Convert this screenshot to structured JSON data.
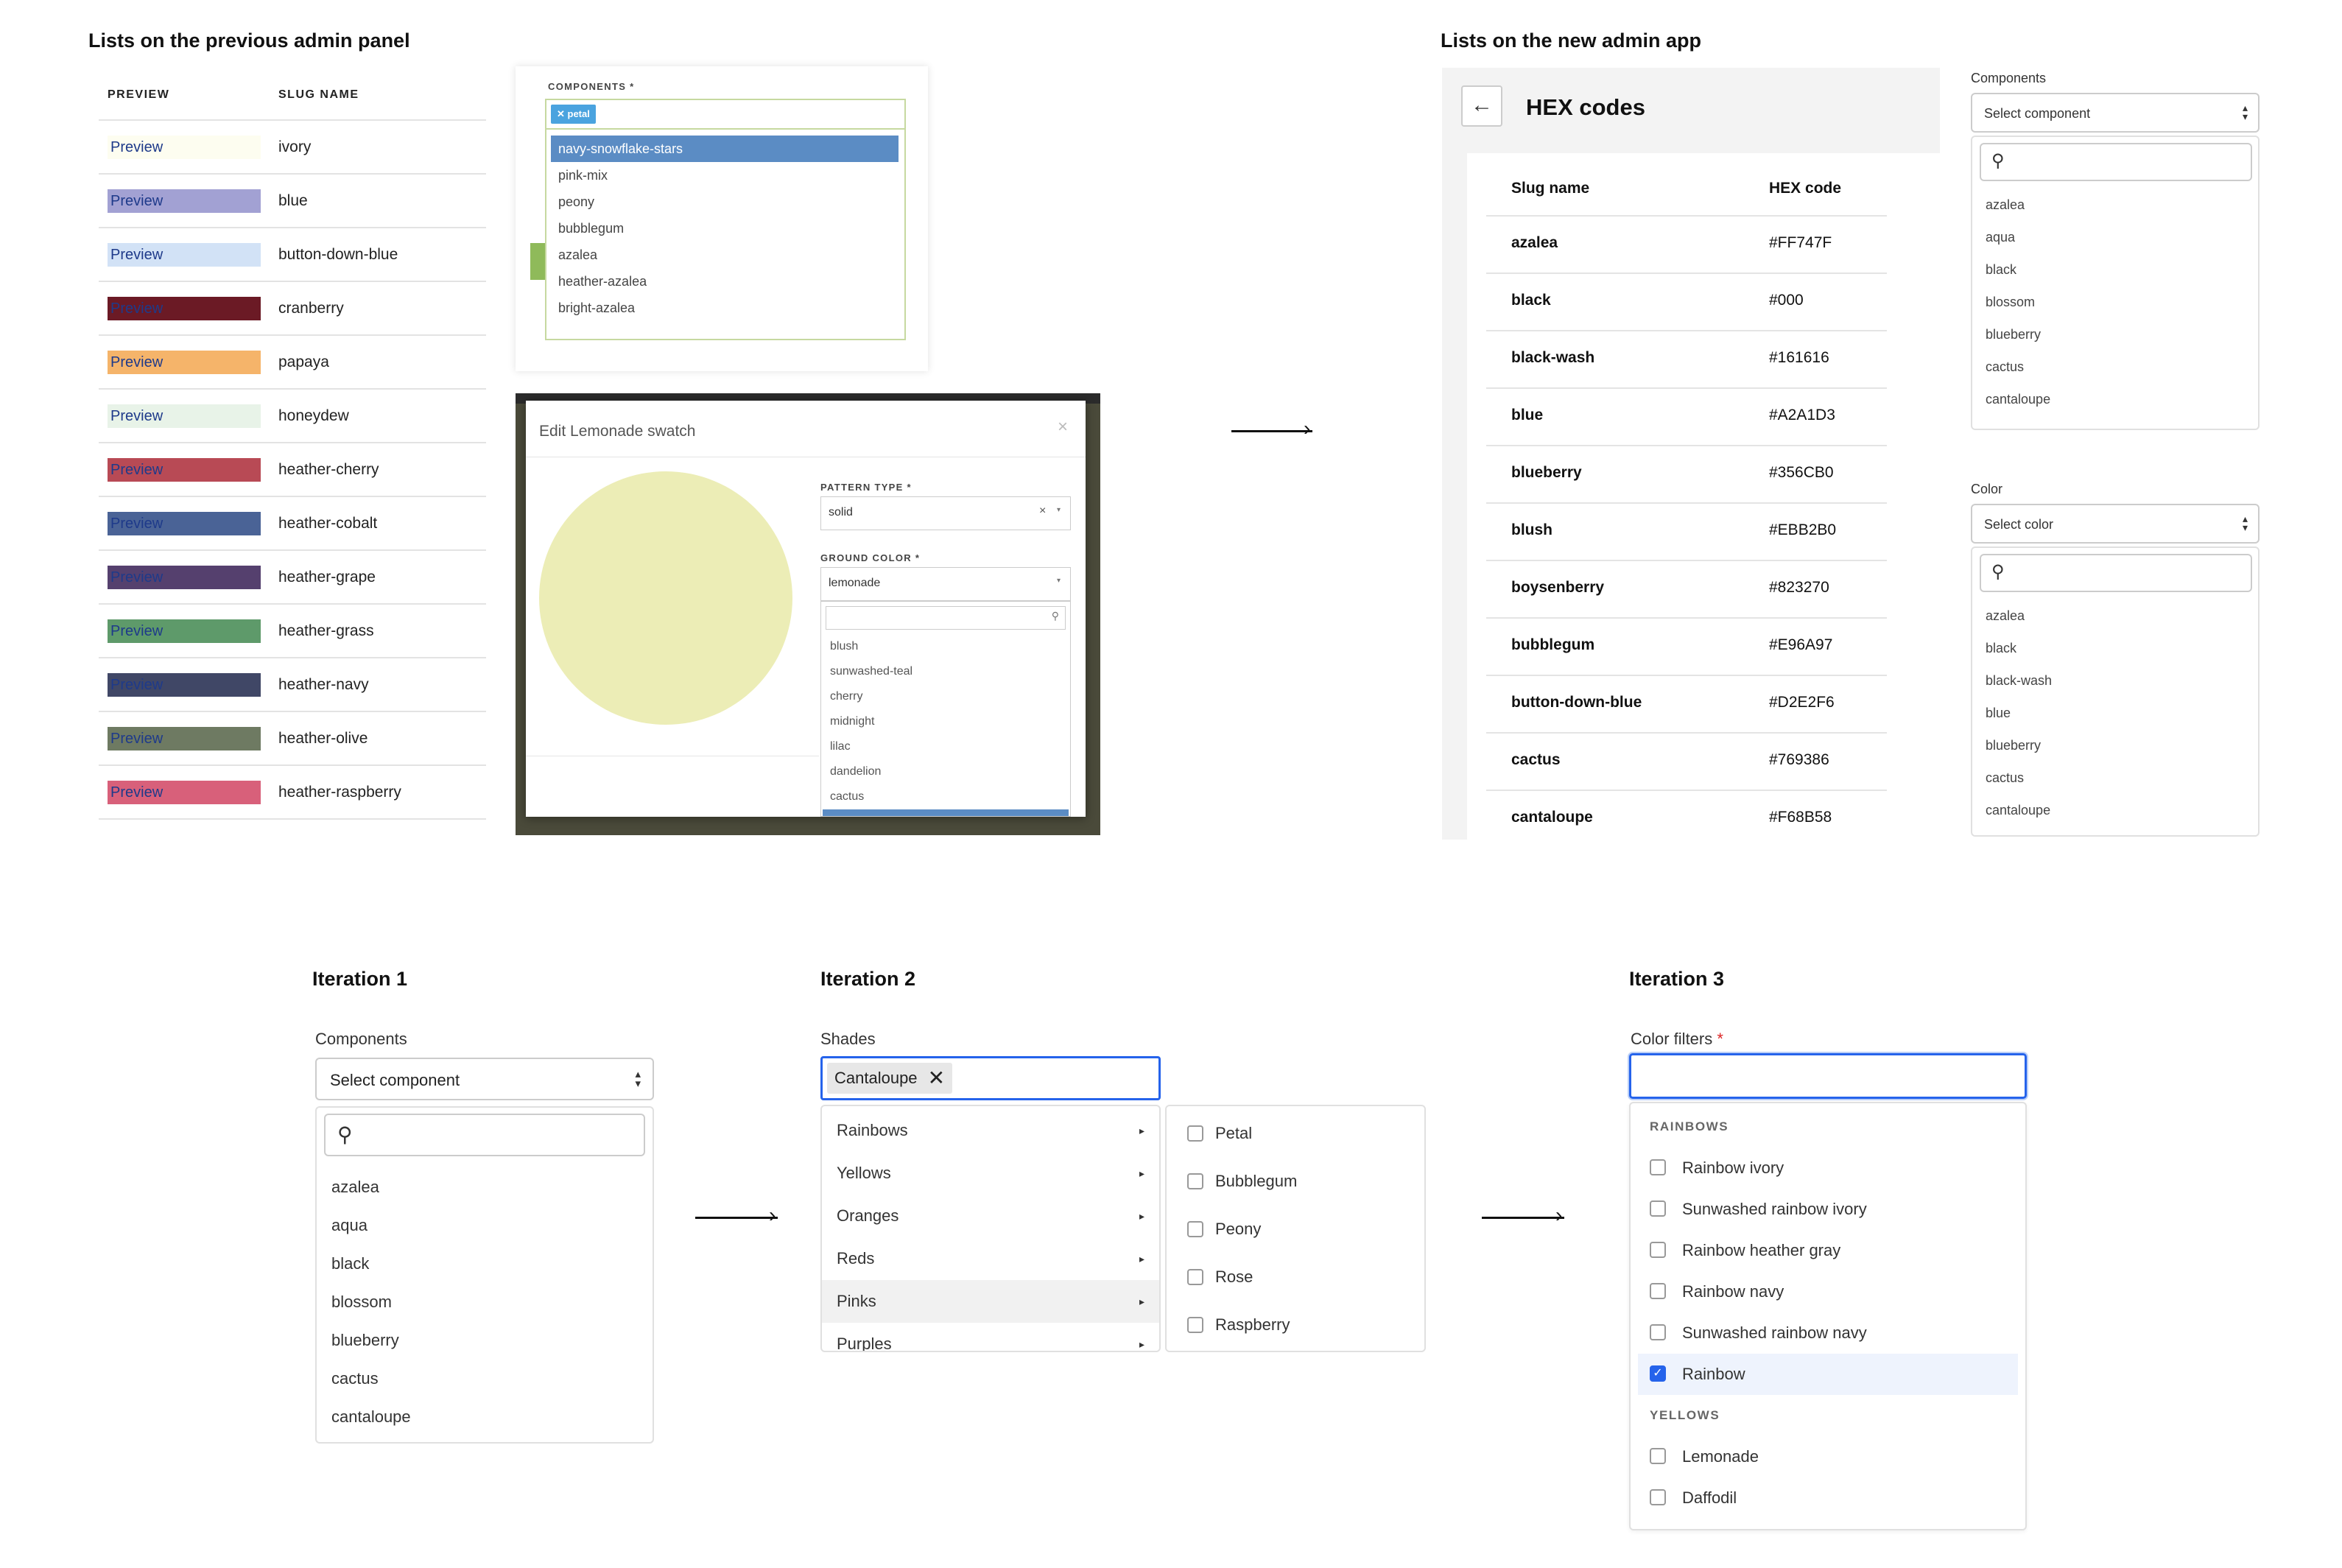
{
  "old_panel": {
    "heading": "Lists on the previous admin panel",
    "col_preview": "PREVIEW",
    "col_slug": "SLUG NAME",
    "preview_text": "Preview",
    "rows": [
      {
        "slug": "ivory",
        "color": "#fdfdf0"
      },
      {
        "slug": "blue",
        "color": "#a2a1d3"
      },
      {
        "slug": "button-down-blue",
        "color": "#d2e2f6"
      },
      {
        "slug": "cranberry",
        "color": "#6b1a25"
      },
      {
        "slug": "papaya",
        "color": "#f5b46a"
      },
      {
        "slug": "honeydew",
        "color": "#e8f3e8"
      },
      {
        "slug": "heather-cherry",
        "color": "#b84a55"
      },
      {
        "slug": "heather-cobalt",
        "color": "#4a6396"
      },
      {
        "slug": "heather-grape",
        "color": "#55406e"
      },
      {
        "slug": "heather-grass",
        "color": "#5e9a6a"
      },
      {
        "slug": "heather-navy",
        "color": "#404766"
      },
      {
        "slug": "heather-olive",
        "color": "#6e7a62"
      },
      {
        "slug": "heather-raspberry",
        "color": "#d8607a"
      }
    ]
  },
  "old_components": {
    "label": "COMPONENTS *",
    "tag": "petal",
    "options": [
      "navy-snowflake-stars",
      "pink-mix",
      "peony",
      "bubblegum",
      "azalea",
      "heather-azalea",
      "bright-azalea"
    ],
    "selected_index": 0
  },
  "old_modal": {
    "title": "Edit Lemonade swatch",
    "close": "×",
    "swatch_color": "#ecedb6",
    "pattern_label": "PATTERN TYPE *",
    "pattern_value": "solid",
    "ground_label": "GROUND COLOR *",
    "ground_value": "lemonade",
    "options": [
      "blush",
      "sunwashed-teal",
      "cherry",
      "midnight",
      "lilac",
      "dandelion",
      "cactus",
      "lemonade"
    ],
    "selected": "lemonade"
  },
  "new_app": {
    "heading": "Lists on the new admin app",
    "back_icon": "arrow-left-icon",
    "title": "HEX codes",
    "col_slug": "Slug name",
    "col_hex": "HEX code",
    "rows": [
      {
        "slug": "azalea",
        "hex": "#FF747F"
      },
      {
        "slug": "black",
        "hex": "#000"
      },
      {
        "slug": "black-wash",
        "hex": "#161616"
      },
      {
        "slug": "blue",
        "hex": "#A2A1D3"
      },
      {
        "slug": "blueberry",
        "hex": "#356CB0"
      },
      {
        "slug": "blush",
        "hex": "#EBB2B0"
      },
      {
        "slug": "boysenberry",
        "hex": "#823270"
      },
      {
        "slug": "bubblegum",
        "hex": "#E96A97"
      },
      {
        "slug": "button-down-blue",
        "hex": "#D2E2F6"
      },
      {
        "slug": "cactus",
        "hex": "#769386"
      },
      {
        "slug": "cantaloupe",
        "hex": "#F68B58"
      }
    ],
    "components": {
      "label": "Components",
      "placeholder": "Select component",
      "options": [
        "azalea",
        "aqua",
        "black",
        "blossom",
        "blueberry",
        "cactus",
        "cantaloupe"
      ]
    },
    "color": {
      "label": "Color",
      "placeholder": "Select color",
      "options": [
        "azalea",
        "black",
        "black-wash",
        "blue",
        "blueberry",
        "cactus",
        "cantaloupe"
      ]
    }
  },
  "iteration1": {
    "heading": "Iteration 1",
    "label": "Components",
    "placeholder": "Select component",
    "options": [
      "azalea",
      "aqua",
      "black",
      "blossom",
      "blueberry",
      "cactus",
      "cantaloupe"
    ]
  },
  "iteration2": {
    "heading": "Iteration 2",
    "label": "Shades",
    "chip": "Cantaloupe",
    "groups": [
      "Rainbows",
      "Yellows",
      "Oranges",
      "Reds",
      "Pinks",
      "Purples"
    ],
    "active_group": "Pinks",
    "submenu": [
      "Petal",
      "Bubblegum",
      "Peony",
      "Rose",
      "Raspberry"
    ]
  },
  "iteration3": {
    "heading": "Iteration 3",
    "label": "Color filters",
    "required_mark": "*",
    "group1": "RAINBOWS",
    "group1_items": [
      {
        "label": "Rainbow ivory",
        "checked": false
      },
      {
        "label": "Sunwashed rainbow ivory",
        "checked": false
      },
      {
        "label": "Rainbow heather gray",
        "checked": false
      },
      {
        "label": "Rainbow navy",
        "checked": false
      },
      {
        "label": "Sunwashed rainbow navy",
        "checked": false
      },
      {
        "label": "Rainbow",
        "checked": true
      }
    ],
    "group2": "YELLOWS",
    "group2_items": [
      {
        "label": "Lemonade",
        "checked": false
      },
      {
        "label": "Daffodil",
        "checked": false
      }
    ]
  },
  "colors": {
    "accent_blue": "#2563eb",
    "old_selected": "#5b8cc4"
  }
}
